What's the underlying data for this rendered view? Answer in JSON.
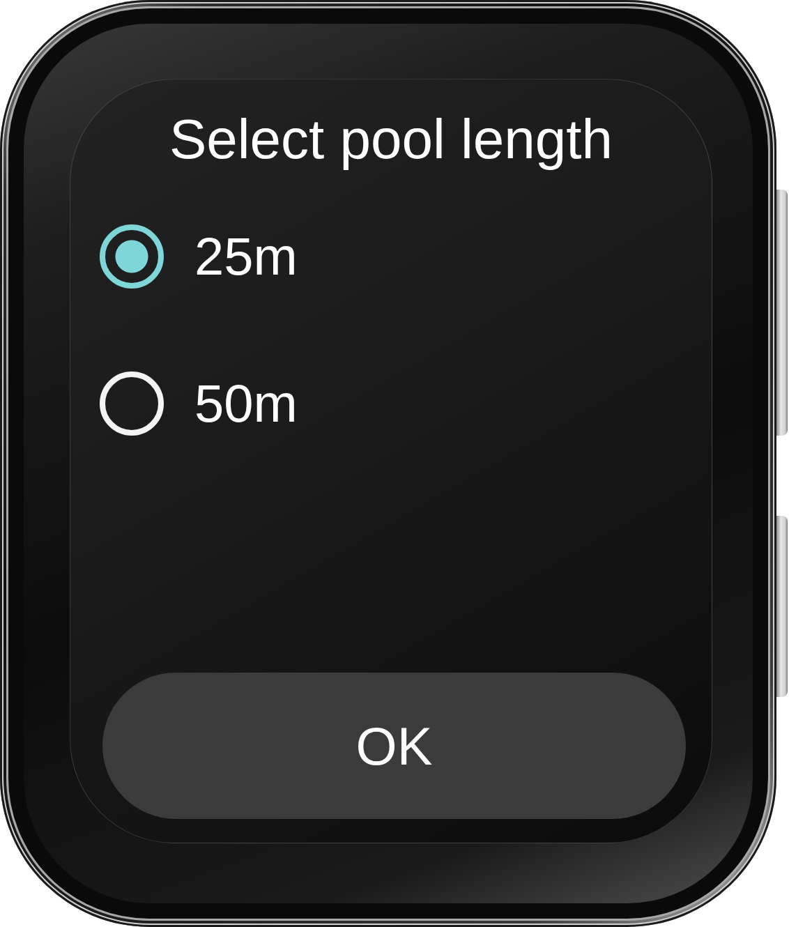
{
  "screen": {
    "title": "Select pool length"
  },
  "options": [
    {
      "label": "25m",
      "selected": true
    },
    {
      "label": "50m",
      "selected": false
    }
  ],
  "confirm_button": {
    "label": "OK"
  }
}
